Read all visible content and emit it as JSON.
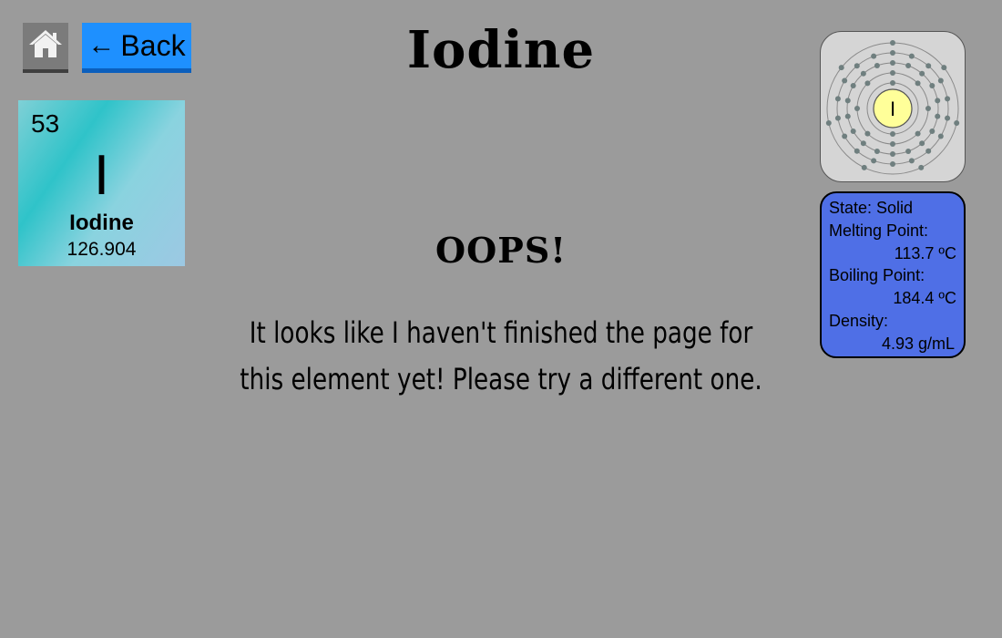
{
  "nav": {
    "home_icon": "home-icon",
    "back_label": "Back",
    "back_arrow": "←"
  },
  "page": {
    "title": "Iodine"
  },
  "element_tile": {
    "atomic_number": "53",
    "symbol": "I",
    "name": "Iodine",
    "atomic_mass": "126.904"
  },
  "bohr_model": {
    "nucleus_symbol": "I",
    "shell_electrons": [
      2,
      8,
      18,
      18,
      7
    ]
  },
  "properties": {
    "state_label": "State: Solid",
    "melting_label": "Melting Point:",
    "melting_value": "113.7 ºC",
    "boiling_label": "Boiling Point:",
    "boiling_value": "184.4 ºC",
    "density_label": "Density:",
    "density_value": "4.93 g/mL"
  },
  "notice": {
    "heading": "OOPS!",
    "line1": "It looks like I haven't finished the page for",
    "line2": "this element yet! Please try a different one."
  },
  "colors": {
    "background": "#9b9b9b",
    "back_button": "#1e90ff",
    "properties_panel": "#4f6fe6",
    "nucleus": "#ffff99"
  }
}
